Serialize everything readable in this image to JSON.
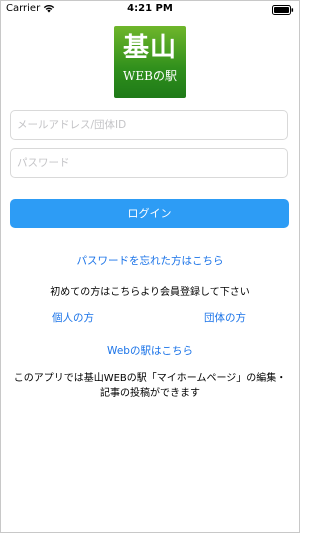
{
  "status_bar": {
    "carrier": "Carrier",
    "time": "4:21 PM"
  },
  "logo": {
    "main": "基山",
    "sub": "WEBの駅",
    "color_top": "#6fb62b",
    "color_bottom": "#1f7a18"
  },
  "form": {
    "email_placeholder": "メールアドレス/団体ID",
    "email_value": "",
    "password_placeholder": "パスワード",
    "password_value": "",
    "login_label": "ログイン",
    "accent_color": "#2d9cf5"
  },
  "links": {
    "forgot_password": "パスワードを忘れた方はこちら",
    "first_time": "初めての方はこちらより会員登録して下さい",
    "individual": "個人の方",
    "group": "団体の方",
    "web_station": "Webの駅はこちら",
    "link_color": "#1a73e8"
  },
  "description": "このアプリでは基山WEBの駅「マイホームページ」の編集・記事の投稿ができます"
}
